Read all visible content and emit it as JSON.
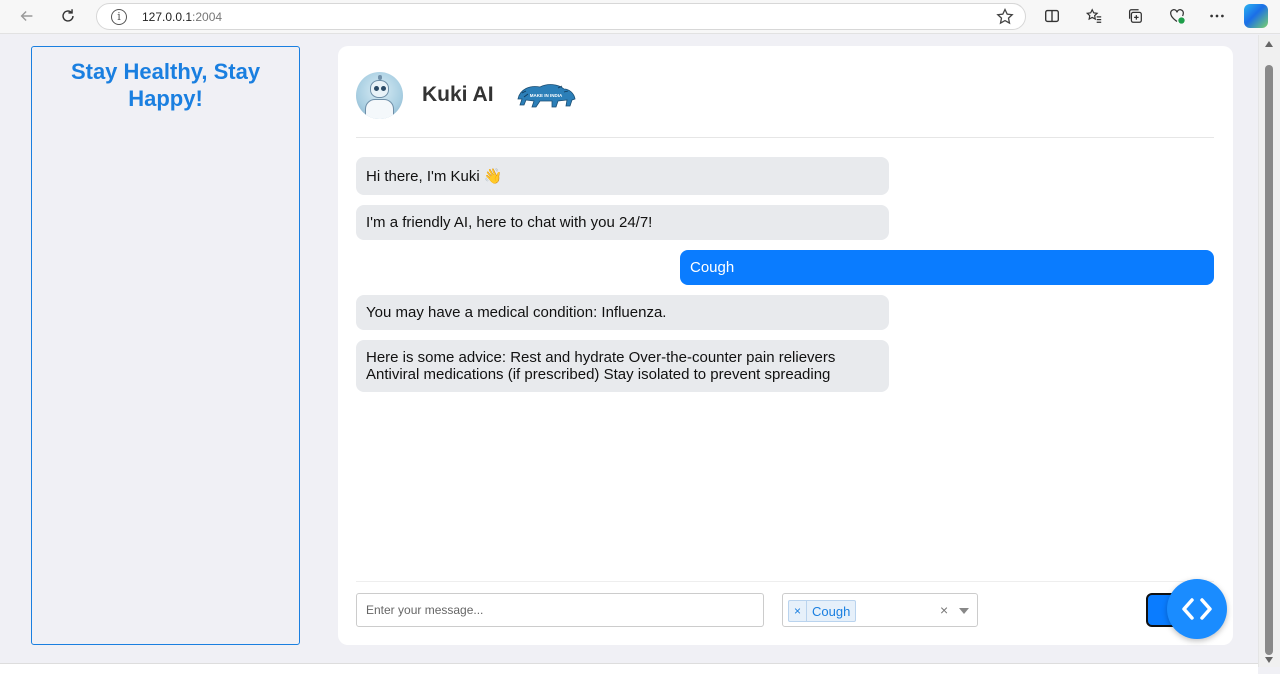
{
  "browser": {
    "url_host": "127.0.0.1",
    "url_port": ":2004",
    "icons": [
      "back-icon",
      "reload-icon",
      "info-icon",
      "star-icon",
      "split-screen-icon",
      "favorites-icon",
      "collections-icon",
      "health-icon",
      "more-icon",
      "copilot-icon"
    ]
  },
  "sidebar": {
    "title": "Stay Healthy, Stay Happy!"
  },
  "chat": {
    "bot_name": "Kuki AI",
    "messages": [
      {
        "role": "bot",
        "text": "Hi there, I'm Kuki 👋"
      },
      {
        "role": "bot",
        "text": "I'm a friendly AI, here to chat with you 24/7!"
      },
      {
        "role": "user",
        "text": "Cough"
      },
      {
        "role": "bot",
        "text": "You may have a medical condition: Influenza."
      },
      {
        "role": "bot",
        "text": "Here is some advice: Rest and hydrate Over-the-counter pain relievers Antiviral medications (if prescribed) Stay isolated to prevent spreading"
      }
    ],
    "input_placeholder": "Enter your message...",
    "selected_symptom": "Cough",
    "tag_remove": "×",
    "clear_symbol": "×"
  },
  "colors": {
    "accent": "#1a7fe0",
    "user_bubble": "#0a7cff",
    "bot_bubble": "#e8eaed"
  }
}
